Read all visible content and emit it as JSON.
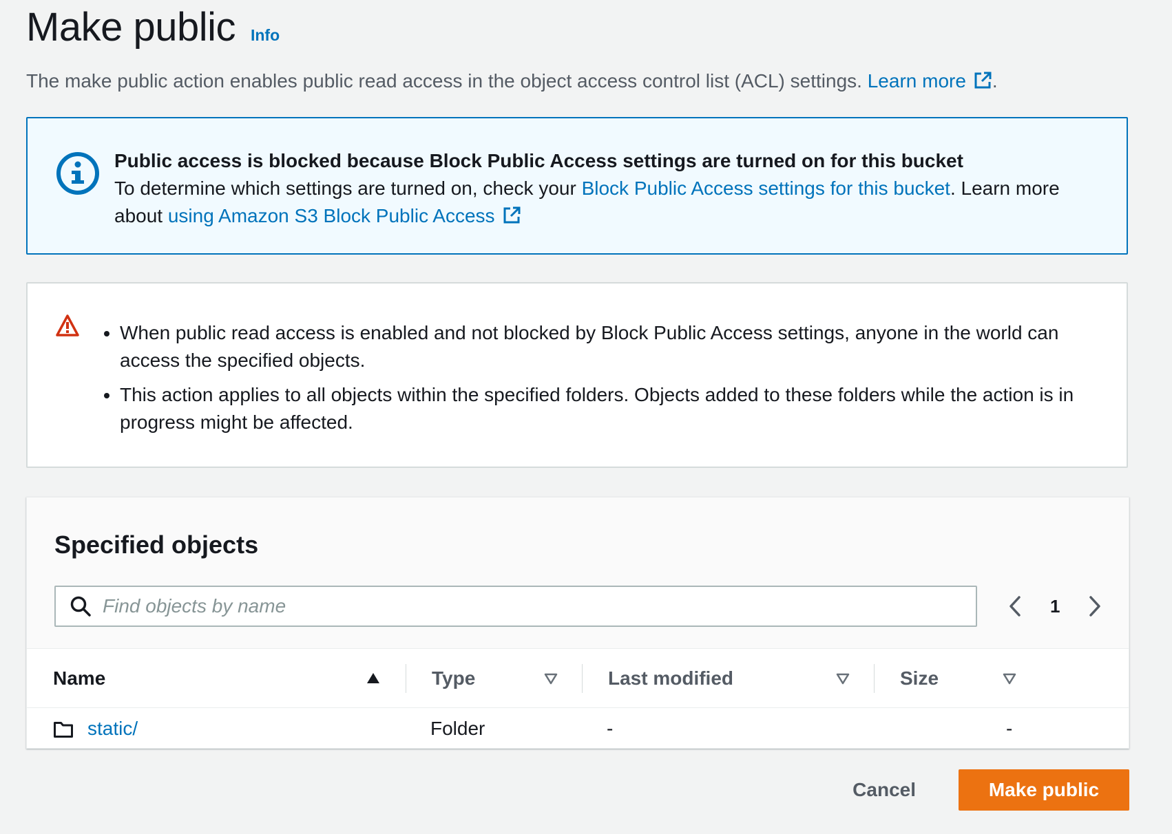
{
  "header": {
    "title": "Make public",
    "info_link": "Info"
  },
  "description": {
    "text": "The make public action enables public read access in the object access control list (ACL) settings.",
    "learn_more": "Learn more",
    "trailing": "."
  },
  "info_alert": {
    "heading": "Public access is blocked because Block Public Access settings are turned on for this bucket",
    "text_before": "To determine which settings are turned on, check your ",
    "settings_link": "Block Public Access settings for this bucket",
    "text_middle": ". Learn more about ",
    "bpa_link": "using Amazon S3 Block Public Access",
    "icon": "info-circle-icon",
    "color": "#0073bb"
  },
  "warning_alert": {
    "icon": "warning-triangle-icon",
    "color": "#d13212",
    "items": [
      "When public read access is enabled and not blocked by Block Public Access settings, anyone in the world can access the specified objects.",
      "This action applies to all objects within the specified folders. Objects added to these folders while the action is in progress might be affected."
    ]
  },
  "objects": {
    "title": "Specified objects",
    "search_placeholder": "Find objects by name",
    "search_value": "",
    "current_page": "1",
    "columns": {
      "name": "Name",
      "type": "Type",
      "last_modified": "Last modified",
      "size": "Size"
    },
    "sort": {
      "column": "name",
      "direction": "ascending"
    },
    "rows": [
      {
        "name": "static/",
        "type": "Folder",
        "last_modified": "-",
        "size": "-",
        "icon": "folder-icon"
      }
    ]
  },
  "actions": {
    "cancel": "Cancel",
    "confirm": "Make public",
    "confirm_color": "#ec7211"
  }
}
